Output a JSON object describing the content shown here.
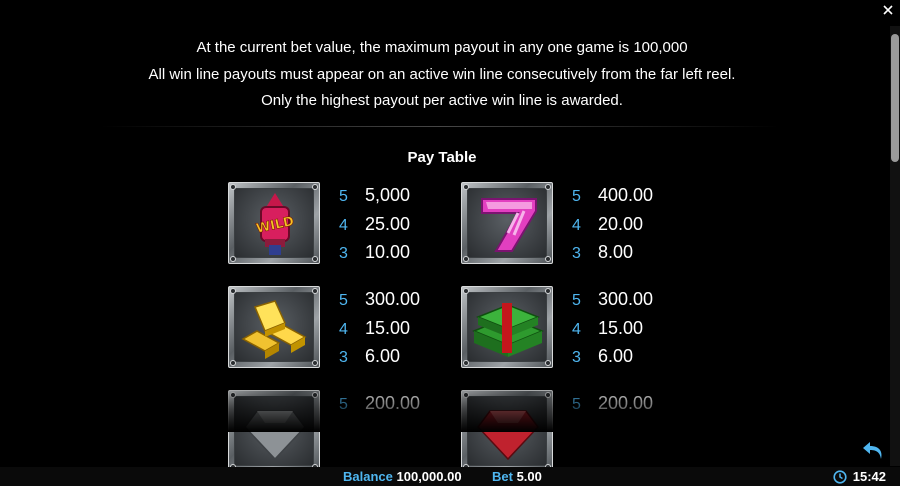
{
  "info_lines": [
    "At the current bet value, the maximum payout in any one game is 100,000",
    "All win line payouts must appear on an active win line consecutively from the far left reel.",
    "Only the highest payout per active win line is awarded."
  ],
  "pay_table": {
    "title": "Pay Table",
    "symbols": [
      {
        "icon": "wild-firework-icon",
        "pays": [
          {
            "count": "5",
            "amount": "5,000"
          },
          {
            "count": "4",
            "amount": "25.00"
          },
          {
            "count": "3",
            "amount": "10.00"
          }
        ]
      },
      {
        "icon": "pink-seven-icon",
        "pays": [
          {
            "count": "5",
            "amount": "400.00"
          },
          {
            "count": "4",
            "amount": "20.00"
          },
          {
            "count": "3",
            "amount": "8.00"
          }
        ]
      },
      {
        "icon": "gold-bars-icon",
        "pays": [
          {
            "count": "5",
            "amount": "300.00"
          },
          {
            "count": "4",
            "amount": "15.00"
          },
          {
            "count": "3",
            "amount": "6.00"
          }
        ]
      },
      {
        "icon": "cash-stack-icon",
        "pays": [
          {
            "count": "5",
            "amount": "300.00"
          },
          {
            "count": "4",
            "amount": "15.00"
          },
          {
            "count": "3",
            "amount": "6.00"
          }
        ]
      },
      {
        "icon": "grey-gem-icon",
        "pays": [
          {
            "count": "5",
            "amount": "200.00"
          }
        ]
      },
      {
        "icon": "red-gem-icon",
        "pays": [
          {
            "count": "5",
            "amount": "200.00"
          }
        ]
      }
    ]
  },
  "footer": {
    "balance_label": "Balance",
    "balance_value": "100,000.00",
    "bet_label": "Bet",
    "bet_value": "5.00",
    "time": "15:42"
  },
  "colors": {
    "accent": "#4fb6f0",
    "background": "#000000"
  },
  "icons": {
    "back": "back-arrow-icon",
    "clock": "clock-icon",
    "close": "close-icon"
  }
}
